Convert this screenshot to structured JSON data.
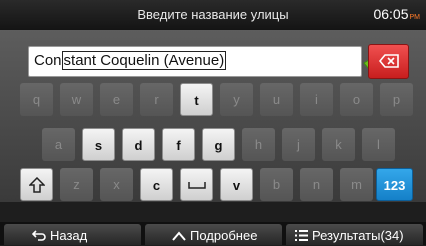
{
  "header": {
    "title": "Введите название улицы",
    "time": "06:05",
    "ampm": "PM"
  },
  "input": {
    "prefix": "Con",
    "selected": "stant Coquelin (Avenue)"
  },
  "keyboard": {
    "row1": [
      "q",
      "w",
      "e",
      "r",
      "t",
      "y",
      "u",
      "i",
      "o",
      "p"
    ],
    "row2": [
      "a",
      "s",
      "d",
      "f",
      "g",
      "h",
      "j",
      "k",
      "l"
    ],
    "row3": [
      "z",
      "x",
      "c",
      "space",
      "v",
      "b",
      "n",
      "m"
    ],
    "mode_key": "123"
  },
  "footer": {
    "back_label": "Назад",
    "more_label": "Подробнее",
    "results_label": "Результаты(34)"
  },
  "colors": {
    "accent_red": "#d9302c",
    "accent_blue": "#1e8fd6",
    "check_green": "#6fbf1f",
    "clock_ampm": "#ff7c2a"
  }
}
